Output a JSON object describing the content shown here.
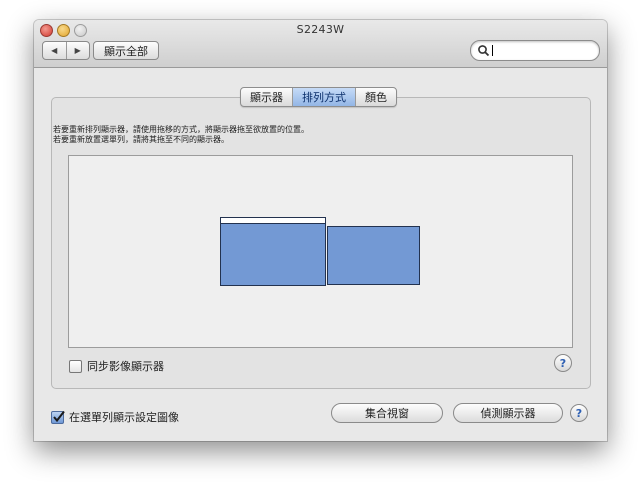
{
  "window": {
    "title": "S2243W"
  },
  "toolbar": {
    "back_glyph": "◀",
    "forward_glyph": "▶",
    "show_all_label": "顯示全部",
    "search": {
      "placeholder": "",
      "value": ""
    }
  },
  "tabs": [
    {
      "label": "顯示器",
      "selected": false
    },
    {
      "label": "排列方式",
      "selected": true
    },
    {
      "label": "顏色",
      "selected": false
    }
  ],
  "instructions": {
    "line1": "若要重新排列顯示器，請使用拖移的方式，將顯示器拖至欲放置的位置。",
    "line2": "若要重新放置選單列，請將其拖至不同的顯示器。"
  },
  "mirror_displays": {
    "label": "同步影像顯示器",
    "checked": false
  },
  "show_in_menubar": {
    "label": "在選單列顯示設定圖像",
    "checked": true
  },
  "buttons": {
    "gather_windows": "集合視窗",
    "detect_displays": "偵測顯示器"
  },
  "help_glyph": "?",
  "colors": {
    "monitor_fill": "#7399d4",
    "tab_selected": "#a9c6ee",
    "window_bg": "#e8e8e8"
  }
}
